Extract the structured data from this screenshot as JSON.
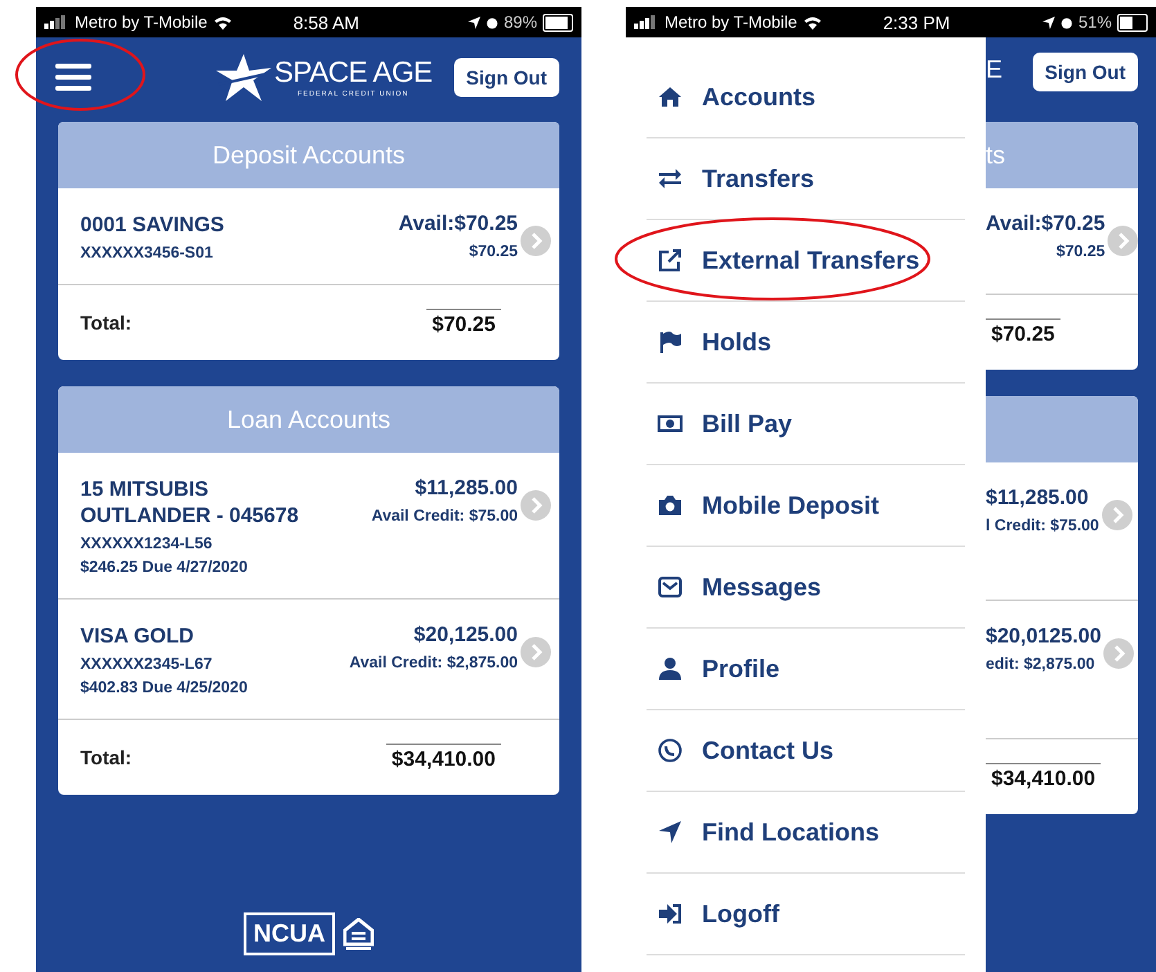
{
  "home_screen": {
    "status_bar": {
      "carrier": "Metro by T-Mobile",
      "time": "8:58 AM",
      "battery": "89%"
    },
    "header": {
      "menu_circled": true,
      "logo_title": "SPACE AGE",
      "logo_subtitle": "FEDERAL CREDIT UNION",
      "sign_out": "Sign Out"
    },
    "sections": [
      {
        "title": "Deposit Accounts",
        "accounts": [
          {
            "name": "0001 SAVINGS",
            "number": "XXXXXX3456-S01",
            "amount": "Avail:$70.25",
            "detail": "$70.25"
          }
        ],
        "total_label": "Total:",
        "total": "$70.25"
      },
      {
        "title": "Loan Accounts",
        "accounts": [
          {
            "name": "15 MITSUBIS OUTLANDER - 045678",
            "number": "XXXXXX1234-L56",
            "due": "$246.25 Due 4/27/2020",
            "amount": "$11,285.00",
            "detail": "Avail Credit: $75.00"
          },
          {
            "name": "VISA GOLD",
            "number": "XXXXXX2345-L67",
            "due": "$402.83 Due 4/25/2020",
            "amount": "$20,125.00",
            "detail": "Avail Credit: $2,875.00"
          }
        ],
        "total_label": "Total:",
        "total": "$34,410.00"
      }
    ],
    "footer": {
      "badge": "NCUA"
    }
  },
  "menu_screen": {
    "status_bar": {
      "carrier": "Metro by T-Mobile",
      "time": "2:33 PM",
      "battery": "51%"
    },
    "menu": [
      {
        "label": "Accounts",
        "kind": "home",
        "circled": false
      },
      {
        "label": "Transfers",
        "kind": "swap",
        "circled": false
      },
      {
        "label": "External Transfers",
        "kind": "external",
        "circled": true
      },
      {
        "label": "Holds",
        "kind": "flag",
        "circled": false
      },
      {
        "label": "Bill Pay",
        "kind": "bill",
        "circled": false
      },
      {
        "label": "Mobile Deposit",
        "kind": "camera",
        "circled": false
      },
      {
        "label": "Messages",
        "kind": "envelope",
        "circled": false
      },
      {
        "label": "Profile",
        "kind": "person",
        "circled": false
      },
      {
        "label": "Contact Us",
        "kind": "phone",
        "circled": false
      },
      {
        "label": "Find Locations",
        "kind": "location",
        "circled": false
      },
      {
        "label": "Logoff",
        "kind": "logoff",
        "circled": false
      }
    ],
    "peek": {
      "logo_fragment": "E",
      "sign_out": "Sign Out",
      "sections": [
        {
          "title": "ts",
          "rows": [
            {
              "amount": "Avail:$70.25",
              "detail": "$70.25"
            }
          ],
          "total": "$70.25"
        },
        {
          "rows": [
            {
              "amount": "$11,285.00",
              "detail": "l Credit: $75.00"
            },
            {
              "amount": "$20,0125.00",
              "detail": "edit: $2,875.00"
            }
          ],
          "total": "$34,410.00"
        }
      ]
    }
  }
}
